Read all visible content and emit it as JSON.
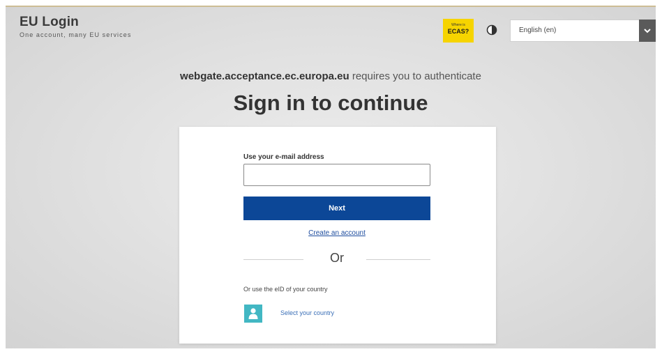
{
  "header": {
    "title": "EU Login",
    "subtitle": "One account, many EU services",
    "ecas_badge_small": "Where is",
    "ecas_badge_big": "ECAS?",
    "contrast_icon": "contrast-icon",
    "language_value": "English (en)",
    "language_icon": "chevron-down-icon"
  },
  "auth": {
    "domain": "webgate.acceptance.ec.europa.eu",
    "requires_text": " requires you to authenticate",
    "headline": "Sign in to continue"
  },
  "form": {
    "email_label": "Use your e-mail address",
    "email_value": "",
    "email_placeholder": "",
    "next_label": "Next",
    "create_account": "Create an account",
    "or_text": "Or",
    "eid_text": "Or use the eID of your country",
    "country_icon": "user-icon",
    "select_country": "Select your country"
  },
  "colors": {
    "accent_blue": "#0c4797",
    "badge_yellow": "#f6d400",
    "country_teal": "#42b7c3",
    "link_blue": "#1d4c9e"
  }
}
